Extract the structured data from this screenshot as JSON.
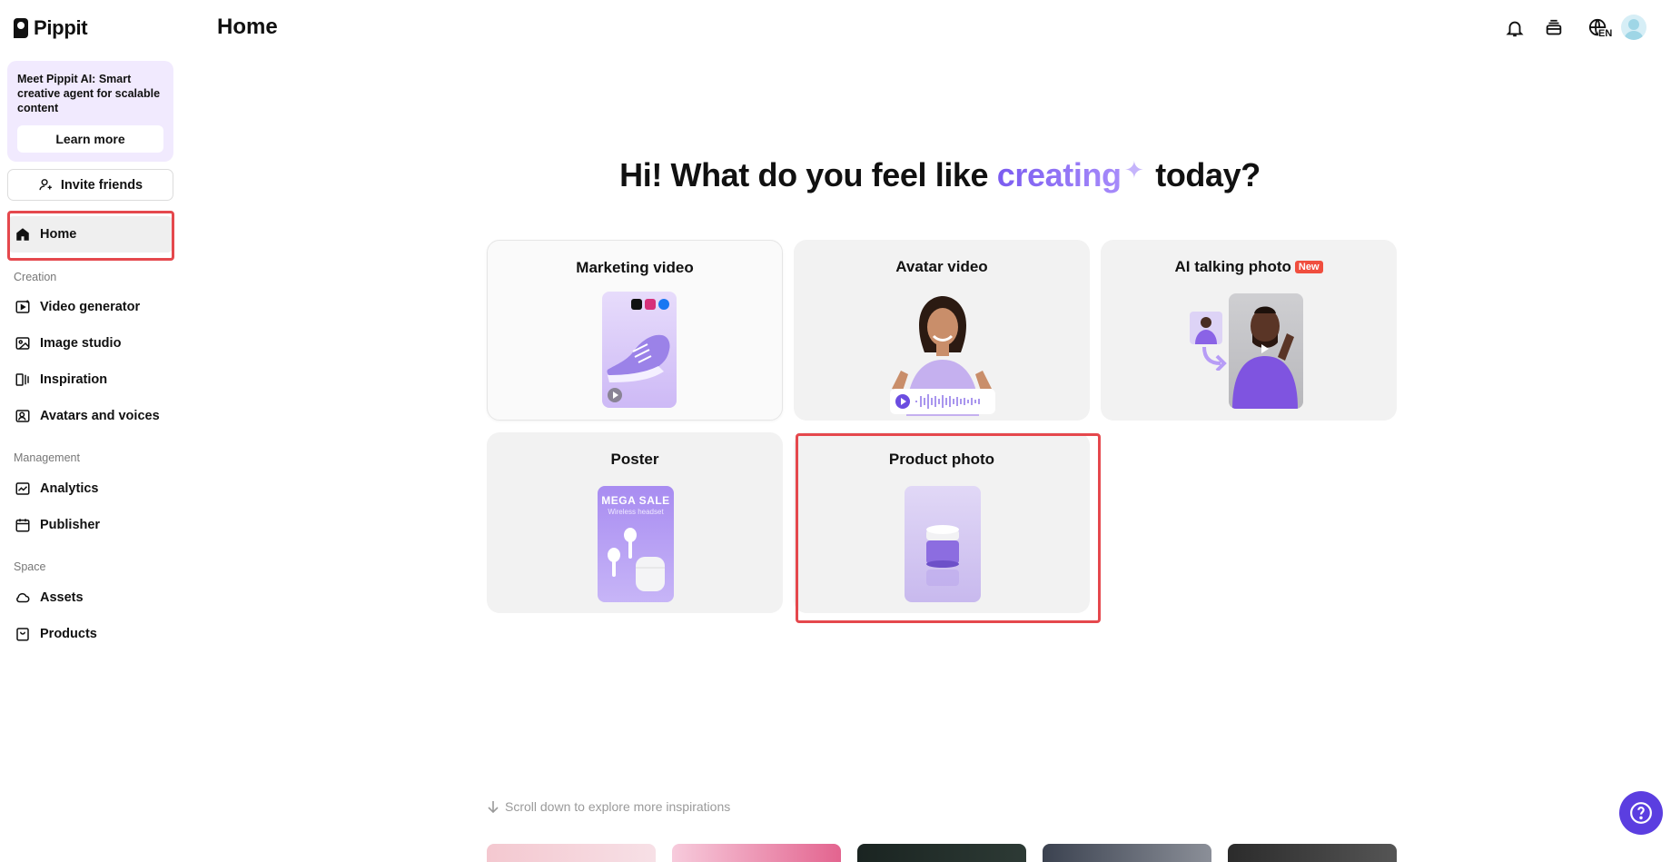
{
  "app": {
    "name": "Pippit"
  },
  "promo": {
    "text": "Meet Pippit AI: Smart creative agent for scalable content",
    "button_label": "Learn more"
  },
  "invite_label": "Invite friends",
  "nav": {
    "home": "Home",
    "sections": {
      "creation": "Creation",
      "management": "Management",
      "space": "Space"
    },
    "creation_items": [
      "Video generator",
      "Image studio",
      "Inspiration",
      "Avatars and voices"
    ],
    "management_items": [
      "Analytics",
      "Publisher"
    ],
    "space_items": [
      "Assets",
      "Products"
    ]
  },
  "header": {
    "title": "Home",
    "language": "EN"
  },
  "headline": {
    "prefix": "Hi! What do you feel like",
    "accent": "creating",
    "suffix": "today?"
  },
  "cards": {
    "marketing_video": "Marketing video",
    "avatar_video": "Avatar video",
    "ai_talking_photo": "AI talking photo",
    "ai_talking_photo_badge": "New",
    "poster": "Poster",
    "poster_sale": "MEGA SALE",
    "poster_sub": "Wireless headset",
    "product_photo": "Product photo"
  },
  "scroll_hint": "Scroll down to explore more inspirations",
  "colors": {
    "accent": "#7b5cf0",
    "highlight": "#e5484d",
    "help": "#5b3ee0"
  }
}
